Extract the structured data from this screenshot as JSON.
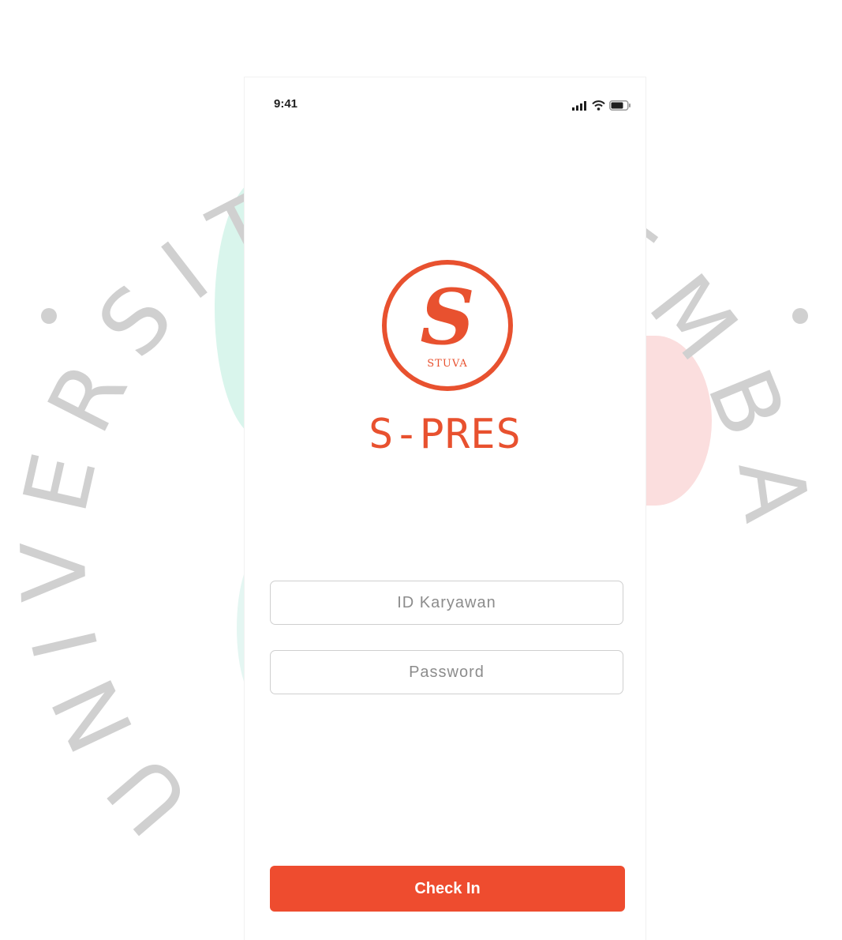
{
  "status_bar": {
    "time": "9:41",
    "icons": [
      "signal-icon",
      "wifi-icon",
      "battery-icon"
    ]
  },
  "logo": {
    "monogram": "S",
    "wordmark": "STUVA"
  },
  "app": {
    "title": "S-PRES"
  },
  "form": {
    "id_placeholder": "ID Karyawan",
    "id_value": "",
    "password_placeholder": "Password",
    "password_value": ""
  },
  "actions": {
    "check_in_label": "Check In"
  },
  "watermark": {
    "text": "UNIVERSITAS PEMBANGUNAN JAYA"
  },
  "colors": {
    "accent": "#EE4C2F",
    "brand_red": "#E8512F",
    "watermark_gray": "#D0D0D0",
    "blob_mint": "#D9F5EC",
    "blob_pink": "#FBDEDE"
  }
}
